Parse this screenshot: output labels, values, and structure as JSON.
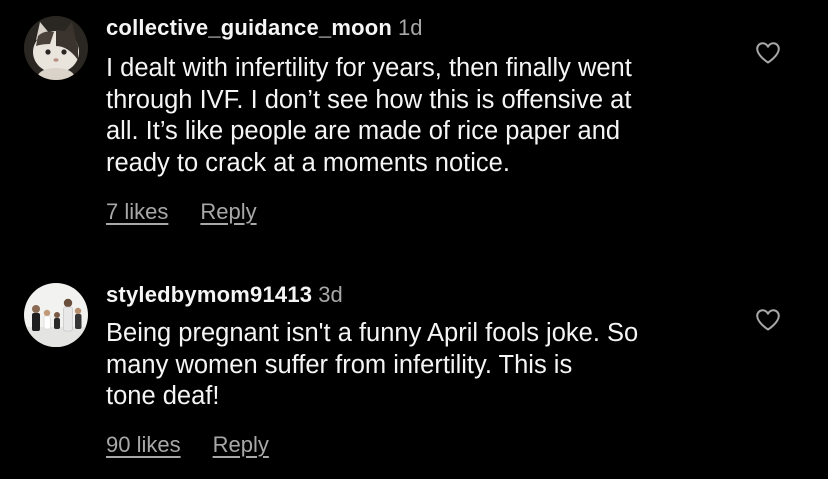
{
  "comments": [
    {
      "username": "collective_guidance_moon",
      "time_ago": "1d",
      "text": "I dealt with infertility for years, then finally went\nthrough IVF.  I don’t see how this is offensive at\nall.  It’s like people are made of rice paper and\nready to crack at a moments notice.",
      "likes_label": "7 likes",
      "reply_label": "Reply",
      "avatar_icon": "cat-avatar",
      "like_icon": "heart-outline-icon"
    },
    {
      "username": "styledbymom91413",
      "time_ago": "3d",
      "text": "Being pregnant isn't a funny April fools joke. So\nmany women suffer from infertility.  This is\ntone deaf!",
      "likes_label": "90 likes",
      "reply_label": "Reply",
      "avatar_icon": "family-photo-avatar",
      "like_icon": "heart-outline-icon"
    }
  ],
  "colors": {
    "background": "#000000",
    "primary_text": "#f5f5f5",
    "secondary_text": "#a8a8a8"
  }
}
